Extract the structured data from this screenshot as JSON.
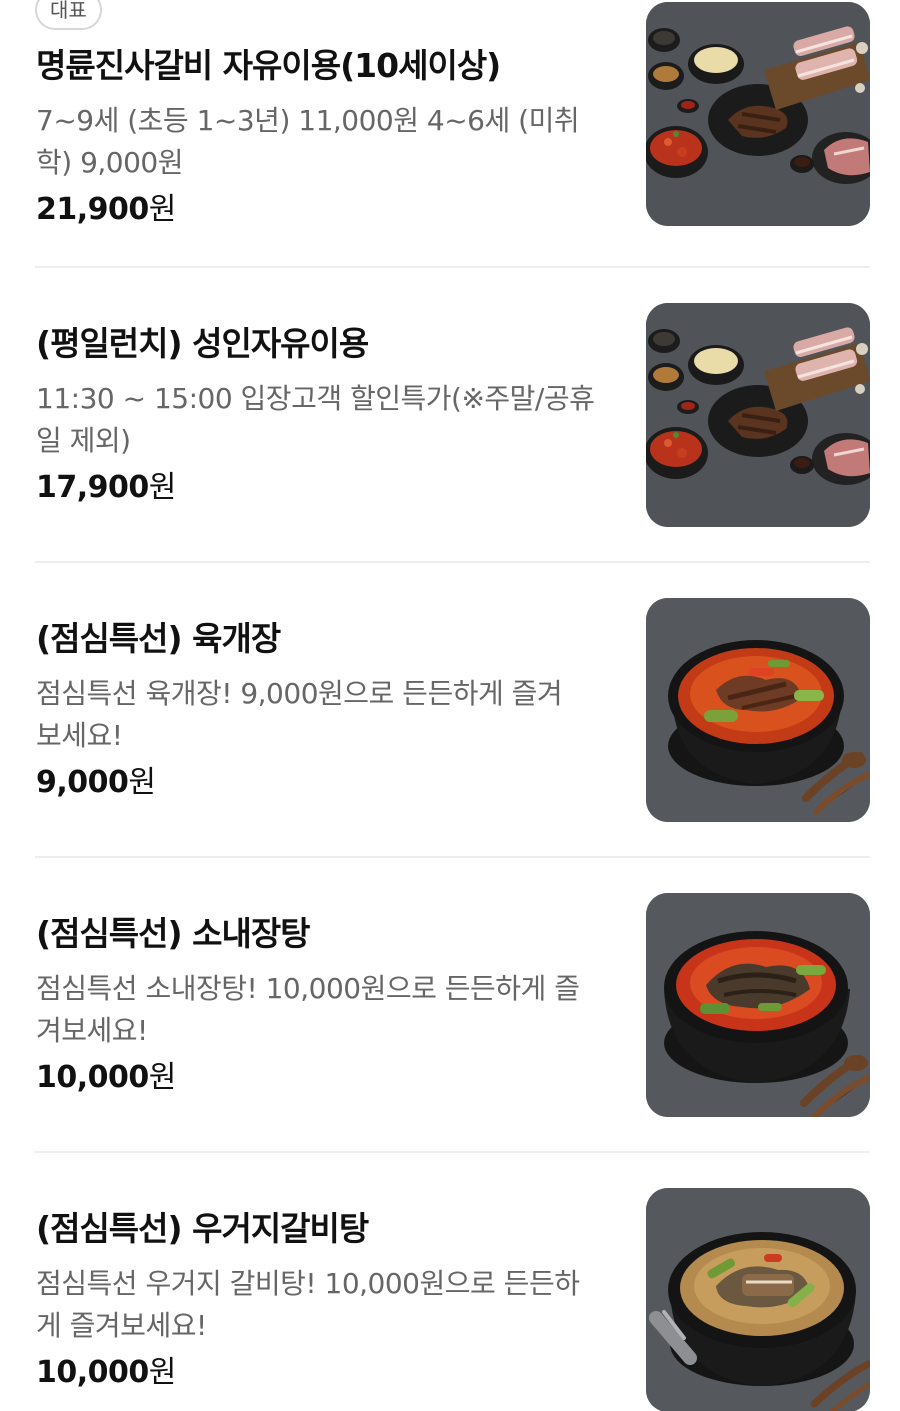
{
  "menu": {
    "badge_label": "대표",
    "items": [
      {
        "name": "명륜진사갈비 자유이용(10세이상)",
        "desc_lines": [
          "7~9세 (초등 1~3년) 11,000원 4~6세 (미취",
          "학) 9,000원"
        ],
        "price_number": "21,900",
        "price_unit": "원",
        "image_icon": "bbq-platter-photo"
      },
      {
        "name": "(평일런치) 성인자유이용",
        "desc_lines": [
          "11:30 ~ 15:00 입장고객 할인특가(※주말/공휴",
          "일 제외)"
        ],
        "price_number": "17,900",
        "price_unit": "원",
        "image_icon": "bbq-platter-photo"
      },
      {
        "name": "(점심특선) 육개장",
        "desc_lines": [
          "점심특선 육개장! 9,000원으로 든든하게 즐겨",
          "보세요!"
        ],
        "price_number": "9,000",
        "price_unit": "원",
        "image_icon": "spicy-soup-bowl-photo"
      },
      {
        "name": "(점심특선) 소내장탕",
        "desc_lines": [
          "점심특선 소내장탕! 10,000원으로 든든하게 즐",
          "겨보세요!"
        ],
        "price_number": "10,000",
        "price_unit": "원",
        "image_icon": "spicy-soup-bowl-photo"
      },
      {
        "name": "(점심특선) 우거지갈비탕",
        "desc_lines": [
          "점심특선 우거지 갈비탕! 10,000원으로 든든하",
          "게 즐겨보세요!"
        ],
        "price_number": "10,000",
        "price_unit": "원",
        "image_icon": "rib-soup-bowl-photo"
      }
    ]
  },
  "colors": {
    "text_primary": "#111111",
    "text_secondary": "#666666",
    "divider": "#eeeeee",
    "badge_border": "#d7d7d7",
    "photo_background": "#4b4e53"
  }
}
